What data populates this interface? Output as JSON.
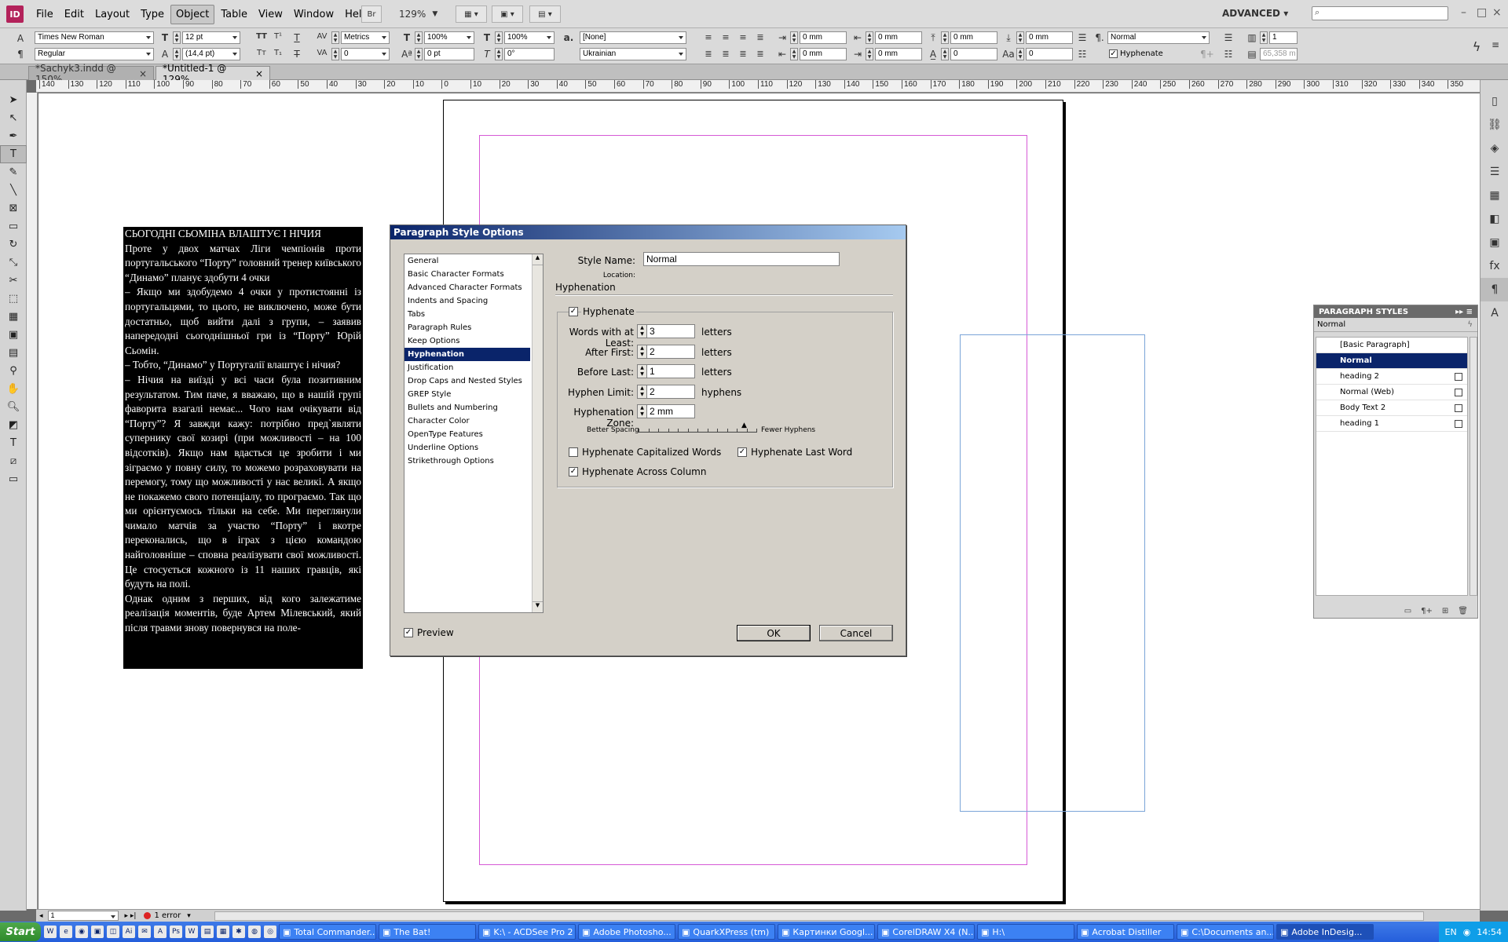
{
  "app": {
    "logo": "ID",
    "workspace": "ADVANCED ▾",
    "zoom": "129%",
    "bridge_label": "Br"
  },
  "menu": [
    "File",
    "Edit",
    "Layout",
    "Type",
    "Object",
    "Table",
    "View",
    "Window",
    "Help"
  ],
  "control": {
    "font_family": "Times New Roman",
    "font_style": "Regular",
    "font_size": "12 pt",
    "leading": "(14,4 pt)",
    "kerning": "Metrics",
    "tracking": "0",
    "vscale": "100%",
    "hscale": "100%",
    "baseline": "0 pt",
    "skew": "0°",
    "char_style": "[None]",
    "language": "Ukrainian",
    "left_indent": "0 mm",
    "right_indent": "0 mm",
    "first_indent": "0 mm",
    "last_indent": "0 mm",
    "space_before": "0 mm",
    "space_after": "0 mm",
    "drop_cap_lines": "0",
    "drop_cap_chars": "0",
    "para_style": "Normal",
    "hyphenate_label": "Hyphenate",
    "columns": "1",
    "width": "65,358 m"
  },
  "tabs": [
    {
      "label": "*Sachyk3.indd @ 150%",
      "close": "×"
    },
    {
      "label": "*Untitled-1 @ 129%",
      "close": "×"
    }
  ],
  "ruler_ticks": [
    "140",
    "130",
    "120",
    "110",
    "100",
    "90",
    "80",
    "70",
    "60",
    "50",
    "40",
    "30",
    "20",
    "10",
    "0",
    "10",
    "20",
    "30",
    "40",
    "50",
    "60",
    "70",
    "80",
    "90",
    "100",
    "110",
    "120",
    "130",
    "140",
    "150",
    "160",
    "170",
    "180",
    "190",
    "200",
    "210",
    "220",
    "230",
    "240",
    "250",
    "260",
    "270",
    "280",
    "290",
    "300",
    "310",
    "320",
    "330",
    "340",
    "350"
  ],
  "text_frame": [
    "СЬОГОДНІ СЬОМІНА ВЛАШТУЄ І НІЧИЯ",
    "Проте у двох матчах Ліги чемпіонів проти португальського “Порту” головний тренер київського “Динамо” планує здобути 4 очки",
    "– Якщо ми здобудемо 4 очки у протистоянні із португальцями, то цього, не виключено, може бути достатньо, щоб вийти далі з групи, – заявив напередодні сьогоднішньої гри із “Порту” Юрій Сьомін.",
    "– Тобто, “Динамо” у Португалії влаштує і нічия?",
    "– Нічия на виїзді у всі часи була позитивним результатом. Тим паче, я вважаю, що в нашій групі фаворита взагалі немає... Чого нам очікувати від “Порту”? Я завжди кажу: потрібно пред`являти супернику свої козирі (при можливості – на 100 відсотків). Якщо нам вдасться це зробити і ми зіграємо у повну силу, то можемо розраховувати на перемогу, тому що можливості у нас великі. А якщо не покажемо свого потенціалу, то програємо. Так що ми орієнтуємось тільки на себе. Ми переглянули чимало матчів за участю “Порту” і вкотре переконались, що в іграх з цією командою найголовніше – сповна реалізувати свої можливості. Це стосується кожного із 11 наших гравців, які будуть на полі.",
    "Однак одним з перших, від кого залежатиме реалізація моментів, буде Артем Мілевський, який після травми знову повернувся на поле-"
  ],
  "paragraph_styles": {
    "title": "PARAGRAPH STYLES",
    "current": "Normal",
    "items": [
      {
        "label": "[Basic Paragraph]",
        "selected": false,
        "saved": false
      },
      {
        "label": "Normal",
        "selected": true,
        "saved": false
      },
      {
        "label": "heading 2",
        "selected": false,
        "saved": true
      },
      {
        "label": "Normal (Web)",
        "selected": false,
        "saved": true
      },
      {
        "label": "Body Text 2",
        "selected": false,
        "saved": true
      },
      {
        "label": "heading 1",
        "selected": false,
        "saved": true
      }
    ]
  },
  "dialog": {
    "title": "Paragraph Style Options",
    "style_name_label": "Style Name:",
    "style_name": "Normal",
    "location_label": "Location:",
    "section_title": "Hyphenation",
    "categories": [
      "General",
      "Basic Character Formats",
      "Advanced Character Formats",
      "Indents and Spacing",
      "Tabs",
      "Paragraph Rules",
      "Keep Options",
      "Hyphenation",
      "Justification",
      "Drop Caps and Nested Styles",
      "GREP Style",
      "Bullets and Numbering",
      "Character Color",
      "OpenType Features",
      "Underline Options",
      "Strikethrough Options"
    ],
    "selected_category": "Hyphenation",
    "hyphenate": {
      "label": "Hyphenate",
      "checked": true
    },
    "fields": [
      {
        "label": "Words with at Least:",
        "value": "3",
        "unit": "letters"
      },
      {
        "label": "After First:",
        "value": "2",
        "unit": "letters"
      },
      {
        "label": "Before Last:",
        "value": "1",
        "unit": "letters"
      },
      {
        "label": "Hyphen Limit:",
        "value": "2",
        "unit": "hyphens"
      },
      {
        "label": "Hyphenation Zone:",
        "value": "2 mm",
        "unit": ""
      }
    ],
    "slider": {
      "left": "Better Spacing",
      "right": "Fewer Hyphens",
      "level": 0.9
    },
    "hyph_caps": {
      "label": "Hyphenate Capitalized Words",
      "checked": false
    },
    "hyph_last": {
      "label": "Hyphenate Last Word",
      "checked": true
    },
    "hyph_across": {
      "label": "Hyphenate Across Column",
      "checked": true
    },
    "preview": {
      "label": "Preview",
      "checked": true
    },
    "ok": "OK",
    "cancel": "Cancel"
  },
  "status": {
    "page": "1",
    "errors": "1 error"
  },
  "taskbar": {
    "start": "Start",
    "items": [
      {
        "label": "Total Commander...",
        "active": false
      },
      {
        "label": "The Bat!",
        "active": false
      },
      {
        "label": "K:\\ - ACDSee Pro 2",
        "active": false
      },
      {
        "label": "Adobe Photosho...",
        "active": false
      },
      {
        "label": "QuarkXPress (tm)",
        "active": false
      },
      {
        "label": "Картинки Googl...",
        "active": false
      },
      {
        "label": "CorelDRAW X4 (N...",
        "active": false
      },
      {
        "label": "H:\\",
        "active": false
      },
      {
        "label": "Acrobat Distiller",
        "active": false
      },
      {
        "label": "C:\\Documents an...",
        "active": false
      },
      {
        "label": "Adobe InDesig...",
        "active": true
      }
    ],
    "lang": "EN",
    "time": "14:54"
  }
}
